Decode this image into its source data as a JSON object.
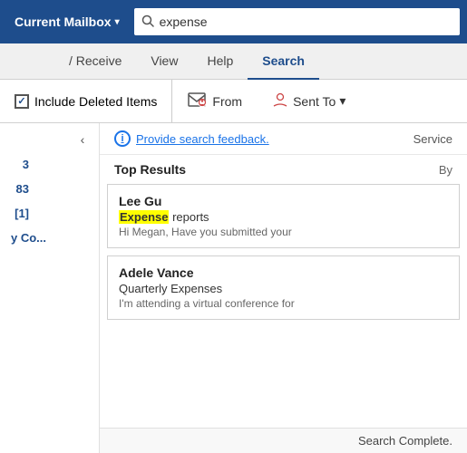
{
  "header": {
    "mailbox_label": "Current Mailbox",
    "chevron": "▾",
    "search_placeholder": "expense",
    "search_value": "expense"
  },
  "ribbon_tabs": {
    "tabs": [
      {
        "label": "/ Receive",
        "active": false
      },
      {
        "label": "View",
        "active": false
      },
      {
        "label": "Help",
        "active": false
      },
      {
        "label": "Search",
        "active": true
      }
    ]
  },
  "search_ribbon": {
    "checkbox_label": "Include Deleted Items",
    "from_label": "From",
    "sent_to_label": "Sent To",
    "chevron": "▾"
  },
  "sidebar": {
    "collapse_icon": "‹",
    "items": [
      {
        "count": "3",
        "label": ""
      },
      {
        "count": "83",
        "label": ""
      },
      {
        "count": "[1]",
        "label": ""
      },
      {
        "count": "y Co...",
        "label": ""
      }
    ]
  },
  "results": {
    "feedback_text": "Provide search feedback.",
    "service_text": "Service",
    "top_results_label": "Top Results",
    "by_label": "By",
    "items": [
      {
        "sender": "Lee Gu",
        "subject_before_highlight": "",
        "subject_highlight": "Expense",
        "subject_after_highlight": " reports",
        "preview": "Hi Megan,  Have you submitted your"
      },
      {
        "sender": "Adele Vance",
        "subject_before_highlight": "Quarterly Expenses",
        "subject_highlight": "",
        "subject_after_highlight": "",
        "preview": "I'm attending a virtual conference for"
      }
    ],
    "status": "Search Complete."
  }
}
